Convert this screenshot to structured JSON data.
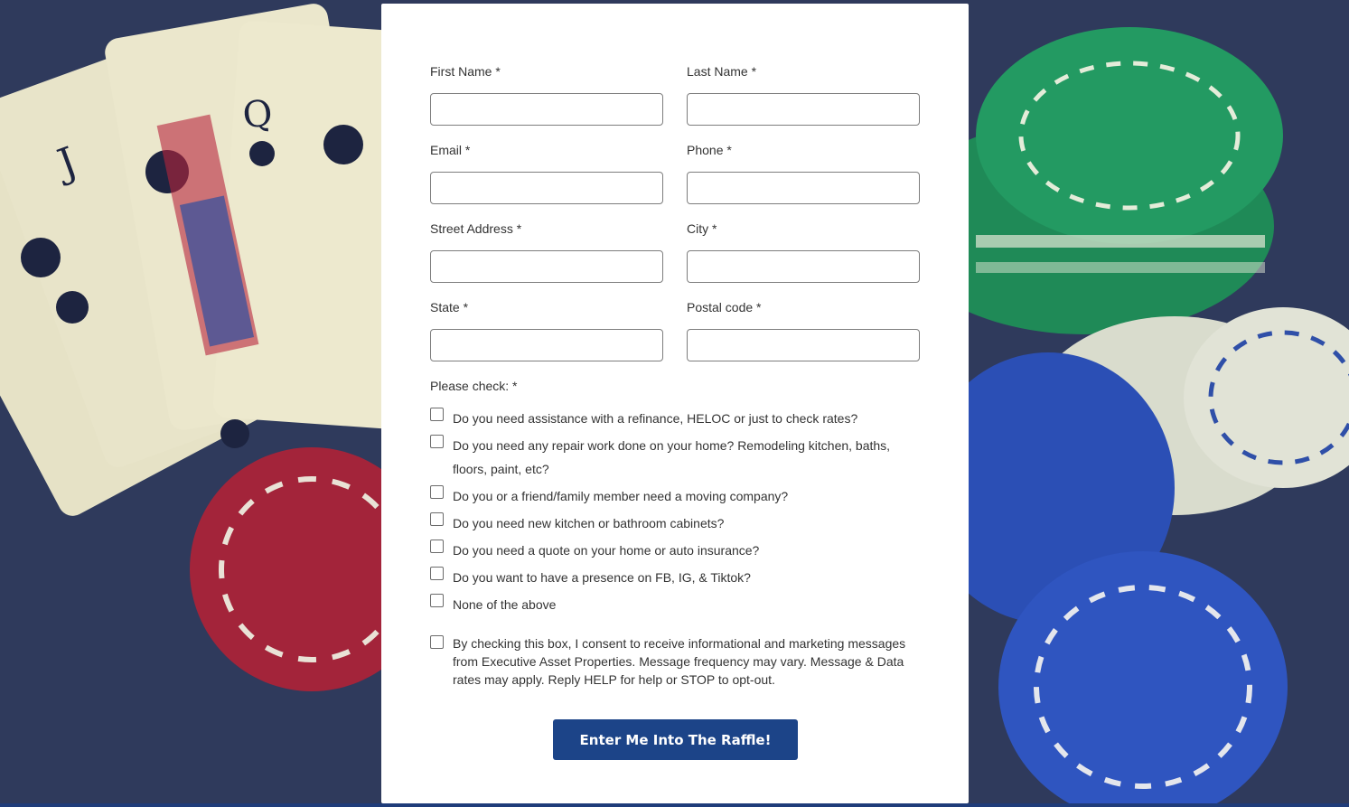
{
  "form": {
    "fields": [
      {
        "label": "First Name *",
        "value": ""
      },
      {
        "label": "Last Name *",
        "value": ""
      },
      {
        "label": "Email *",
        "value": ""
      },
      {
        "label": "Phone *",
        "value": ""
      },
      {
        "label": "Street Address *",
        "value": ""
      },
      {
        "label": "City *",
        "value": ""
      },
      {
        "label": "State *",
        "value": ""
      },
      {
        "label": "Postal code *",
        "value": ""
      }
    ],
    "please_check_label": "Please check: *",
    "options": [
      {
        "label": "Do you need assistance with a refinance, HELOC or just to check rates?",
        "checked": false
      },
      {
        "label": "Do you need any repair work done on your home? Remodeling kitchen, baths, floors, paint, etc?",
        "checked": false
      },
      {
        "label": "Do you or a friend/family member need a moving company?",
        "checked": false
      },
      {
        "label": "Do you need new kitchen or bathroom cabinets?",
        "checked": false
      },
      {
        "label": "Do you need a quote on your home or auto insurance?",
        "checked": false
      },
      {
        "label": "Do you want to have a presence on FB, IG, & Tiktok?",
        "checked": false
      },
      {
        "label": "None of the above",
        "checked": false
      }
    ],
    "consent": {
      "text": "By checking this box, I consent to receive informational and marketing messages from Executive Asset Properties. Message frequency may vary. Message & Data rates may apply. Reply HELP for help or STOP to opt-out.",
      "checked": false
    },
    "submit_label": "Enter Me Into The Raffle!"
  },
  "colors": {
    "background": "#2f3a5c",
    "button": "#1c4488",
    "card": "#ffffff"
  }
}
